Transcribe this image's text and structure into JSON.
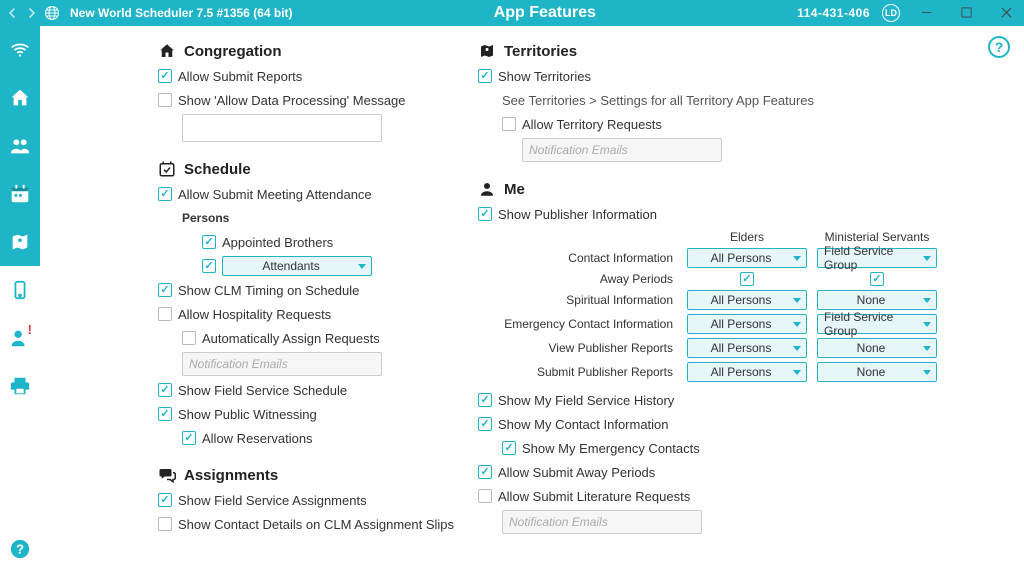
{
  "titlebar": {
    "app_title": "New World Scheduler 7.5 #1356 (64 bit)",
    "page_title": "App Features",
    "account_number": "114-431-406",
    "id_badge": "LD"
  },
  "congregation": {
    "header": "Congregation",
    "allow_submit_reports": {
      "label": "Allow Submit Reports",
      "checked": true
    },
    "show_data_processing": {
      "label": "Show 'Allow Data Processing' Message",
      "checked": false
    },
    "data_processing_text": ""
  },
  "schedule": {
    "header": "Schedule",
    "allow_attendance": {
      "label": "Allow Submit Meeting Attendance",
      "checked": true
    },
    "persons_label": "Persons",
    "appointed": {
      "label": "Appointed Brothers",
      "checked": true
    },
    "attendants": {
      "checked": true,
      "combo": "Attendants"
    },
    "show_clm_timing": {
      "label": "Show CLM Timing on Schedule",
      "checked": true
    },
    "allow_hospitality": {
      "label": "Allow Hospitality Requests",
      "checked": false
    },
    "auto_assign": {
      "label": "Automatically Assign Requests",
      "checked": false
    },
    "notif_placeholder": "Notification Emails",
    "show_field_service": {
      "label": "Show Field Service Schedule",
      "checked": true
    },
    "show_public_witnessing": {
      "label": "Show Public Witnessing",
      "checked": true
    },
    "allow_reservations": {
      "label": "Allow Reservations",
      "checked": true
    }
  },
  "assignments": {
    "header": "Assignments",
    "show_fs_assignments": {
      "label": "Show Field Service Assignments",
      "checked": true
    },
    "show_contact_details": {
      "label": "Show Contact Details on CLM Assignment Slips",
      "checked": false
    }
  },
  "territories": {
    "header": "Territories",
    "show_territories": {
      "label": "Show Territories",
      "checked": true
    },
    "note": "See Territories > Settings for all Territory App Features",
    "allow_territory_requests": {
      "label": "Allow Territory Requests",
      "checked": false
    },
    "notif_placeholder": "Notification Emails"
  },
  "me": {
    "header": "Me",
    "show_publisher_info": {
      "label": "Show Publisher Information",
      "checked": true
    },
    "col_headers": {
      "elders": "Elders",
      "ms": "Ministerial Servants"
    },
    "rows": [
      {
        "label": "Contact Information",
        "elders_combo": "All Persons",
        "ms_combo": "Field Service Group"
      },
      {
        "label": "Away Periods",
        "elders_check": true,
        "ms_check": true
      },
      {
        "label": "Spiritual Information",
        "elders_combo": "All Persons",
        "ms_combo": "None"
      },
      {
        "label": "Emergency Contact Information",
        "elders_combo": "All Persons",
        "ms_combo": "Field Service Group"
      },
      {
        "label": "View Publisher Reports",
        "elders_combo": "All Persons",
        "ms_combo": "None"
      },
      {
        "label": "Submit Publisher Reports",
        "elders_combo": "All Persons",
        "ms_combo": "None"
      }
    ],
    "show_my_fsh": {
      "label": "Show My Field Service History",
      "checked": true
    },
    "show_my_contact": {
      "label": "Show My Contact Information",
      "checked": true
    },
    "show_my_emergency": {
      "label": "Show My Emergency Contacts",
      "checked": true
    },
    "allow_submit_away": {
      "label": "Allow Submit Away Periods",
      "checked": true
    },
    "allow_submit_lit": {
      "label": "Allow Submit Literature Requests",
      "checked": false
    },
    "notif_placeholder": "Notification Emails"
  }
}
